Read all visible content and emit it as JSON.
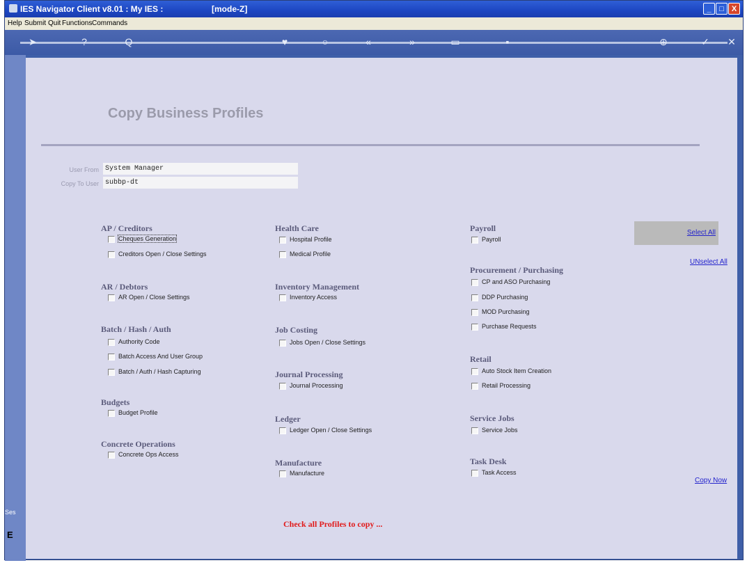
{
  "window": {
    "title": "IES Navigator Client v8.01 : My IES :",
    "mode": "[mode-Z]",
    "buttons": {
      "minimize": "_",
      "maximize": "□",
      "close": "X"
    }
  },
  "menu": [
    "Help",
    "Submit",
    "Quit",
    "Functions",
    "Commands"
  ],
  "toolbar": {
    "icons": [
      "back-arrow-icon",
      "help-icon",
      "search-icon",
      "heart-icon",
      "refresh-icon",
      "rewind-icon",
      "forward-icon",
      "page-icon",
      "square-icon",
      "print-icon",
      "check-icon",
      "close-icon"
    ],
    "glyphs": [
      "➤",
      "?",
      "Q",
      "♥",
      "○",
      "«",
      "»",
      "▭",
      "▪",
      "⊕",
      "✓",
      "✕"
    ]
  },
  "page": {
    "title": "Copy Business Profiles",
    "user_from_label": "User From",
    "user_from_value": "System Manager",
    "copy_to_label": "Copy To User",
    "copy_to_value": "subbp-dt",
    "select_all": "Select All",
    "unselect_all": "UNselect All",
    "copy_now": "Copy Now",
    "warning": "Check all Profiles to copy ..."
  },
  "sections": {
    "ap_creditors": {
      "title": "AP / Creditors",
      "items": [
        "Cheques Generation",
        "Creditors Open / Close Settings"
      ]
    },
    "ar_debtors": {
      "title": "AR / Debtors",
      "items": [
        "AR Open / Close Settings"
      ]
    },
    "batch_hash_auth": {
      "title": "Batch / Hash / Auth",
      "items": [
        "Authority Code",
        "Batch Access And User Group",
        "Batch / Auth / Hash Capturing"
      ]
    },
    "budgets": {
      "title": "Budgets",
      "items": [
        "Budget Profile"
      ]
    },
    "concrete_operations": {
      "title": "Concrete Operations",
      "items": [
        "Concrete Ops Access"
      ]
    },
    "health_care": {
      "title": "Health Care",
      "items": [
        "Hospital Profile",
        "Medical Profile"
      ]
    },
    "inventory_management": {
      "title": "Inventory Management",
      "items": [
        "Inventory Access"
      ]
    },
    "job_costing": {
      "title": "Job Costing",
      "items": [
        "Jobs Open / Close Settings"
      ]
    },
    "journal_processing": {
      "title": "Journal Processing",
      "items": [
        "Journal Processing"
      ]
    },
    "ledger": {
      "title": "Ledger",
      "items": [
        "Ledger Open / Close Settings"
      ]
    },
    "manufacture": {
      "title": "Manufacture",
      "items": [
        "Manufacture"
      ]
    },
    "payroll": {
      "title": "Payroll",
      "items": [
        "Payroll"
      ]
    },
    "procurement": {
      "title": "Procurement / Purchasing",
      "items": [
        "CP and ASO Purchasing",
        "DDP Purchasing",
        "MOD Purchasing",
        "Purchase Requests"
      ]
    },
    "retail": {
      "title": "Retail",
      "items": [
        "Auto Stock Item Creation",
        "Retail Processing"
      ]
    },
    "service_jobs": {
      "title": "Service Jobs",
      "items": [
        "Service Jobs"
      ]
    },
    "task_desk": {
      "title": "Task Desk",
      "items": [
        "Task Access"
      ]
    }
  },
  "side_tabs": [
    "Ses",
    "E"
  ]
}
